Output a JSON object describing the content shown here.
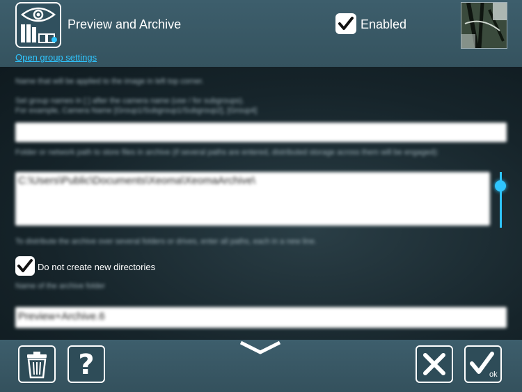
{
  "header": {
    "title": "Preview and Archive",
    "enabled_label": "Enabled",
    "enabled_checked": true,
    "group_settings_link": "Open group settings"
  },
  "form": {
    "name_hint": "Name that will be applied to the image in left top corner.",
    "group_hint_1": "Set group names in [ ] after the camera name (use / for subgroups).",
    "group_hint_2": "For example, Camera Name [Group1/Subgroup1/Subgroup2], [Group4]",
    "name_value": "",
    "path_hint": "Folder or network path to store files in archive (if several paths are entered, distributed storage across them will be engaged):",
    "path_value": "C:\\Users\\Public\\Documents\\Xeoma\\XeomaArchive\\",
    "distribute_hint": "To distribute the archive over several folders or drives, enter all paths, each in a new line.",
    "no_new_dirs_label": "Do not create new directories",
    "no_new_dirs_checked": true,
    "archive_name_hint": "Name of the archive folder",
    "archive_name_value": "Preview+Archive.6"
  },
  "footer": {
    "ok_label": "ok",
    "help_glyph": "?"
  },
  "icons": {
    "module": "eye-archive-icon",
    "delete": "trash-icon",
    "help": "question-icon",
    "cancel": "close-icon",
    "ok": "checkmark-icon",
    "expand": "chevron-down-icon"
  },
  "colors": {
    "accent": "#2fc6ff",
    "header_bg": "#3d5e6c",
    "text": "#ffffff"
  }
}
